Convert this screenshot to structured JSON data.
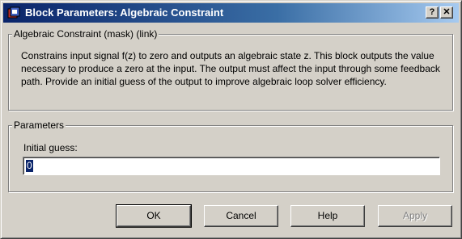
{
  "window": {
    "title": "Block Parameters: Algebraic Constraint",
    "caption_buttons": {
      "help": "?",
      "close": "✕"
    }
  },
  "description_group": {
    "legend": "Algebraic Constraint (mask) (link)",
    "text": "Constrains input signal f(z) to zero and outputs an algebraic state z. This block outputs the value necessary to produce a zero at the input. The output must affect the input through some feedback path. Provide an initial guess of the output to improve algebraic loop solver efficiency."
  },
  "parameters_group": {
    "legend": "Parameters",
    "initial_guess_label": "Initial guess:",
    "initial_guess_value": "0"
  },
  "buttons": {
    "ok": "OK",
    "cancel": "Cancel",
    "help": "Help",
    "apply": "Apply"
  },
  "icons": {
    "app": "simulink-block-icon",
    "help": "question-mark-icon",
    "close": "close-x-icon"
  }
}
